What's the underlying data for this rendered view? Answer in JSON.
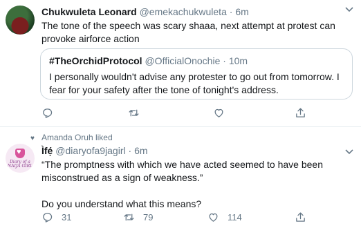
{
  "tweet1": {
    "display_name": "Chukwuleta Leonard",
    "handle": "@emekachukwuleta",
    "separator": "·",
    "time": "6m",
    "text": "The tone of the speech was scary shaaa, next attempt at protest can provoke airforce action",
    "quote": {
      "display_name": "#TheOrchidProtocol",
      "handle": "@OfficialOnochie",
      "separator": "·",
      "time": "10m",
      "text": "I personally wouldn't advise any protester to go out from tomorrow. I fear for your safety after the tone of tonight's address."
    },
    "actions": {
      "reply_icon": "reply-icon",
      "retweet_icon": "retweet-icon",
      "like_icon": "heart-icon",
      "share_icon": "share-icon"
    }
  },
  "tweet2": {
    "liked_by": "Amanda Oruh liked",
    "display_name": "Ìfẹ́",
    "handle": "@diaryofa9jagirl",
    "separator": "·",
    "time": "6m",
    "text_line1": "“The promptness with which we have acted seemed to have been",
    "text_line2": "misconstrued as a sign of weakness.”",
    "text_line3": "Do you understand what this means?",
    "avatar_text": "Diary of a NAIJA GIRL",
    "actions": {
      "reply_count": "31",
      "retweet_count": "79",
      "like_count": "114"
    }
  },
  "colors": {
    "text": "#14171a",
    "muted": "#657786",
    "border": "#e6ecf0"
  }
}
